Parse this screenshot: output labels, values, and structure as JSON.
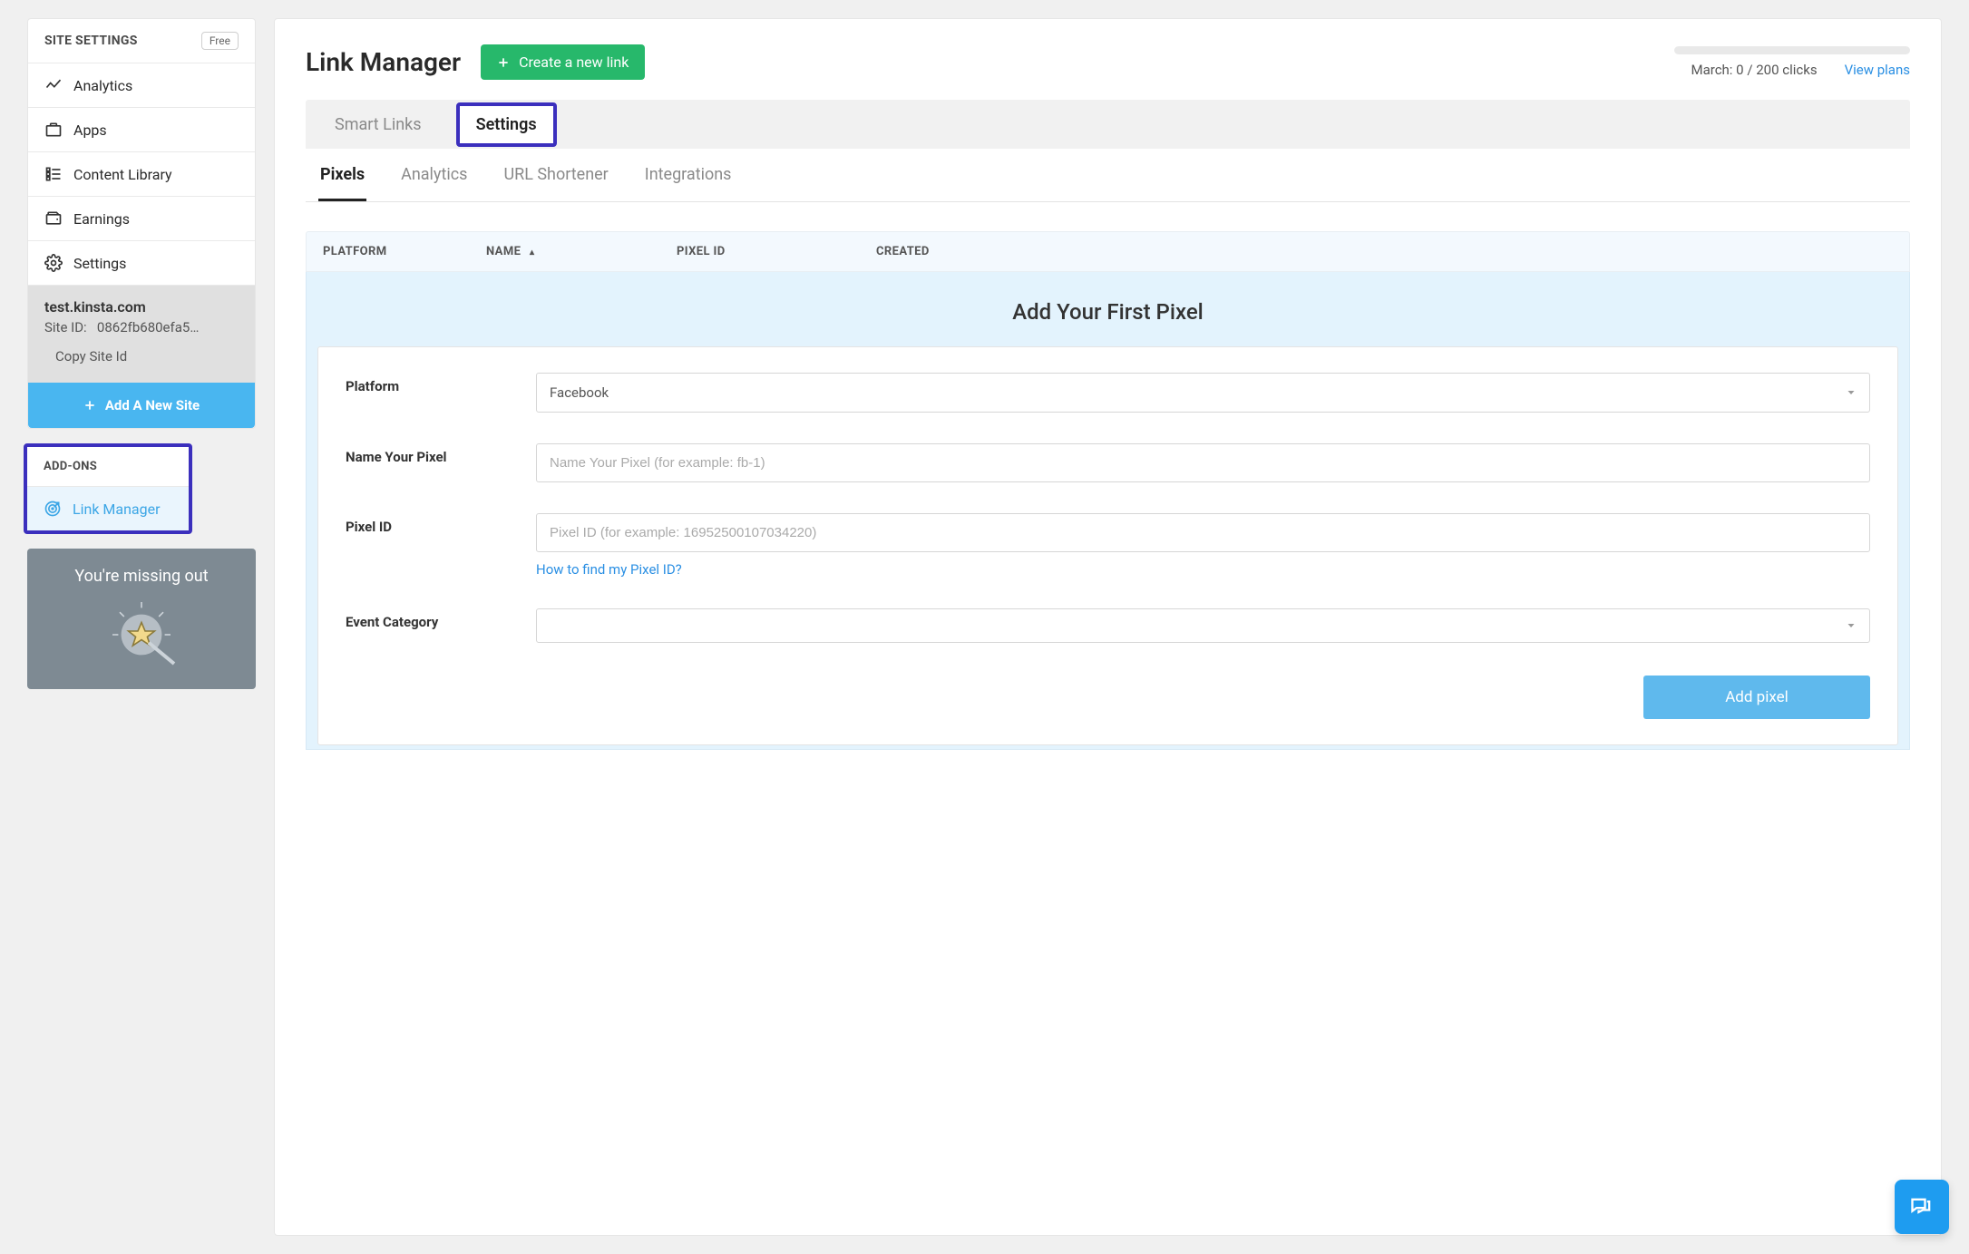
{
  "sidebar": {
    "section_title": "SITE SETTINGS",
    "plan_badge": "Free",
    "nav": [
      {
        "label": "Analytics"
      },
      {
        "label": "Apps"
      },
      {
        "label": "Content Library"
      },
      {
        "label": "Earnings"
      },
      {
        "label": "Settings"
      }
    ],
    "site": {
      "domain": "test.kinsta.com",
      "site_id_label": "Site ID:",
      "site_id_value": "0862fb680efa5…",
      "copy_label": "Copy Site Id"
    },
    "add_site_label": "Add A New Site",
    "addons_title": "ADD-ONS",
    "addons": [
      {
        "label": "Link Manager"
      }
    ],
    "promo_title": "You're missing out"
  },
  "header": {
    "title": "Link Manager",
    "create_label": "Create a new link",
    "clicks_text": "March: 0 / 200 clicks",
    "view_plans": "View plans"
  },
  "top_tabs": [
    {
      "label": "Smart Links",
      "active": false
    },
    {
      "label": "Settings",
      "active": true
    }
  ],
  "sub_tabs": [
    {
      "label": "Pixels",
      "active": true
    },
    {
      "label": "Analytics",
      "active": false
    },
    {
      "label": "URL Shortener",
      "active": false
    },
    {
      "label": "Integrations",
      "active": false
    }
  ],
  "table": {
    "columns": {
      "platform": "PLATFORM",
      "name": "NAME",
      "sort_indicator": "▴",
      "pixel_id": "PIXEL ID",
      "created": "CREATED"
    }
  },
  "pixel_form": {
    "heading": "Add Your First Pixel",
    "fields": {
      "platform": {
        "label": "Platform",
        "value": "Facebook"
      },
      "name": {
        "label": "Name Your Pixel",
        "placeholder": "Name Your Pixel (for example: fb-1)"
      },
      "pixel_id": {
        "label": "Pixel ID",
        "placeholder": "Pixel ID (for example: 16952500107034220)",
        "help": "How to find my Pixel ID?"
      },
      "event_category": {
        "label": "Event Category",
        "value": ""
      }
    },
    "submit_label": "Add pixel"
  }
}
